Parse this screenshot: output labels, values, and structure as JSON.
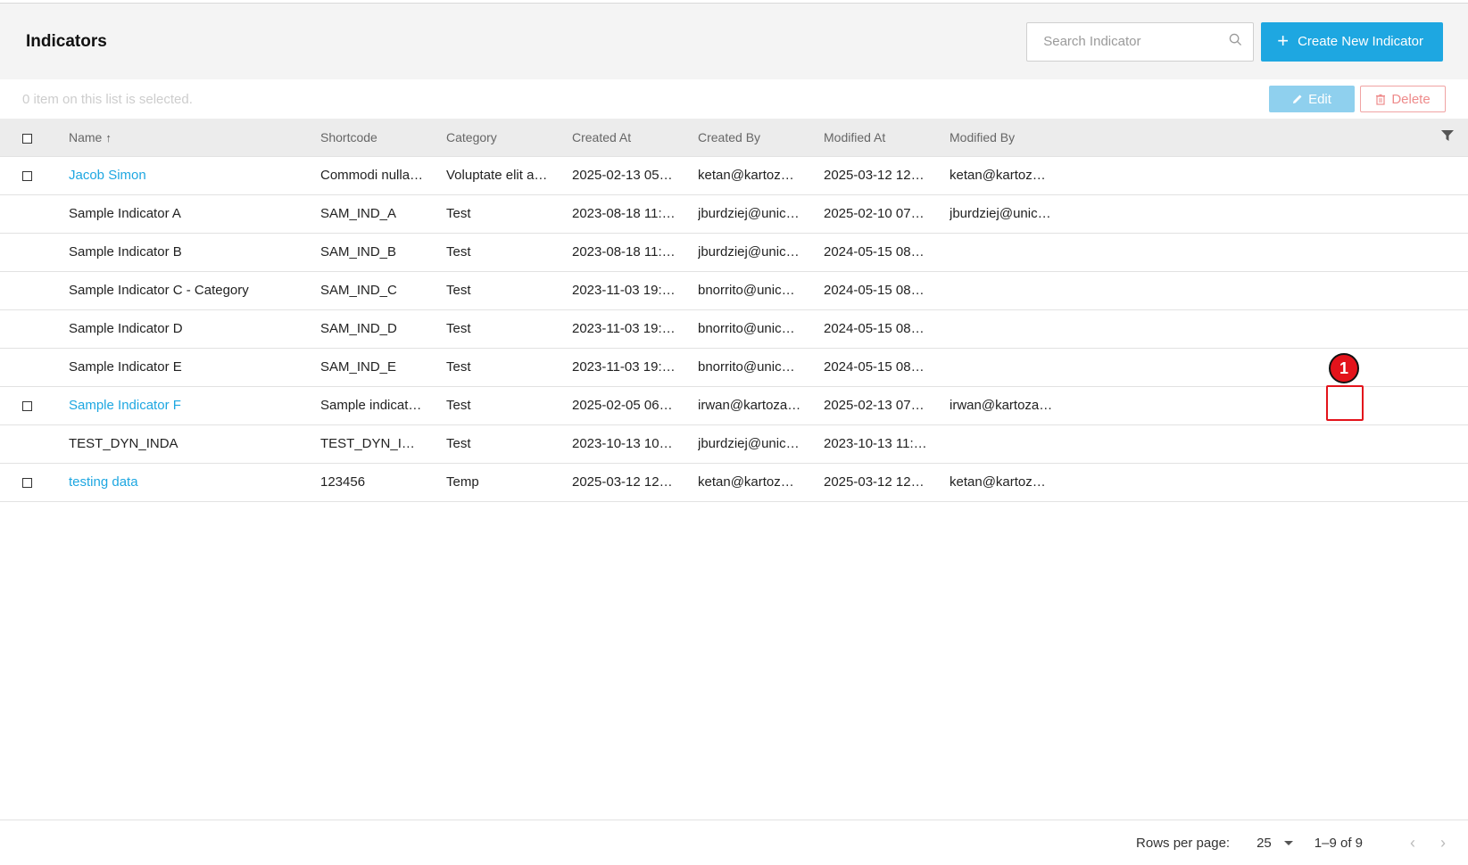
{
  "header": {
    "title": "Indicators",
    "search_placeholder": "Search Indicator",
    "create_label": "Create New Indicator"
  },
  "selection": {
    "text": "0 item on this list is selected.",
    "edit_label": "Edit",
    "delete_label": "Delete"
  },
  "table": {
    "columns": [
      "Name",
      "Shortcode",
      "Category",
      "Created At",
      "Created By",
      "Modified At",
      "Modified By"
    ],
    "sorted_column": "Name",
    "rows": [
      {
        "name": "Jacob Simon",
        "shortcode": "Commodi nulla…",
        "category": "Voluptate elit a…",
        "created_at": "2025-02-13 05…",
        "created_by": "ketan@kartoz…",
        "modified_at": "2025-03-12 12…",
        "modified_by": "ketan@kartoz…"
      },
      {
        "name": "Sample Indicator A",
        "shortcode": "SAM_IND_A",
        "category": "Test",
        "created_at": "2023-08-18 11:…",
        "created_by": "jburdziej@unic…",
        "modified_at": "2025-02-10 07…",
        "modified_by": "jburdziej@unic…"
      },
      {
        "name": "Sample Indicator B",
        "shortcode": "SAM_IND_B",
        "category": "Test",
        "created_at": "2023-08-18 11:…",
        "created_by": "jburdziej@unic…",
        "modified_at": "2024-05-15 08…",
        "modified_by": ""
      },
      {
        "name": "Sample Indicator C - Category",
        "shortcode": "SAM_IND_C",
        "category": "Test",
        "created_at": "2023-11-03 19:…",
        "created_by": "bnorrito@unic…",
        "modified_at": "2024-05-15 08…",
        "modified_by": ""
      },
      {
        "name": "Sample Indicator D",
        "shortcode": "SAM_IND_D",
        "category": "Test",
        "created_at": "2023-11-03 19:…",
        "created_by": "bnorrito@unic…",
        "modified_at": "2024-05-15 08…",
        "modified_by": ""
      },
      {
        "name": "Sample Indicator E",
        "shortcode": "SAM_IND_E",
        "category": "Test",
        "created_at": "2023-11-03 19:…",
        "created_by": "bnorrito@unic…",
        "modified_at": "2024-05-15 08…",
        "modified_by": ""
      },
      {
        "name": "Sample Indicator F",
        "shortcode": "Sample indicat…",
        "category": "Test",
        "created_at": "2025-02-05 06…",
        "created_by": "irwan@kartoza…",
        "modified_at": "2025-02-13 07…",
        "modified_by": "irwan@kartoza…"
      },
      {
        "name": "TEST_DYN_INDA",
        "shortcode": "TEST_DYN_I…",
        "category": "Test",
        "created_at": "2023-10-13 10…",
        "created_by": "jburdziej@unic…",
        "modified_at": "2023-10-13 11:…",
        "modified_by": ""
      },
      {
        "name": "testing data",
        "shortcode": "123456",
        "category": "Temp",
        "created_at": "2025-03-12 12…",
        "created_by": "ketan@kartoz…",
        "modified_at": "2025-03-12 12…",
        "modified_by": "ketan@kartoz…"
      }
    ]
  },
  "annotation": {
    "badge": "1"
  },
  "footer": {
    "rows_per_page_label": "Rows per page:",
    "rows_per_page_value": "25",
    "range": "1–9 of 9"
  },
  "colors": {
    "accent": "#1ea7e1",
    "danger": "#e3131b"
  }
}
